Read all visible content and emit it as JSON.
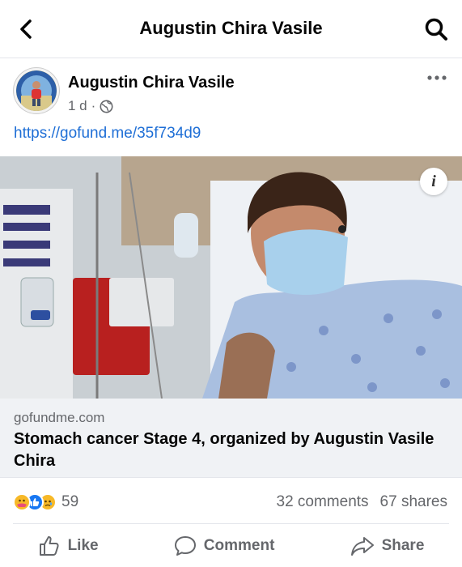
{
  "topbar": {
    "title": "Augustin Chira Vasile",
    "back_icon": "chevron-left-icon",
    "search_icon": "search-icon"
  },
  "post": {
    "author": "Augustin Chira Vasile",
    "time": "1 d",
    "separator": "·",
    "audience_icon": "globe-icon",
    "link_text": "https://gofund.me/35f734d9"
  },
  "link_card": {
    "domain": "gofundme.com",
    "title": "Stomach cancer Stage 4, organized by Augustin Vasile Chira"
  },
  "engagement": {
    "reaction_icons": [
      "care-icon",
      "like-icon",
      "sad-icon"
    ],
    "reaction_count": "59",
    "comments": "32 comments",
    "shares": "67 shares"
  },
  "actions": {
    "like": "Like",
    "comment": "Comment",
    "share": "Share"
  },
  "colors": {
    "link": "#1f6fd6",
    "secondary_text": "#65676b",
    "like_blue": "#1877f2",
    "reaction_yellow": "#f7b928"
  }
}
